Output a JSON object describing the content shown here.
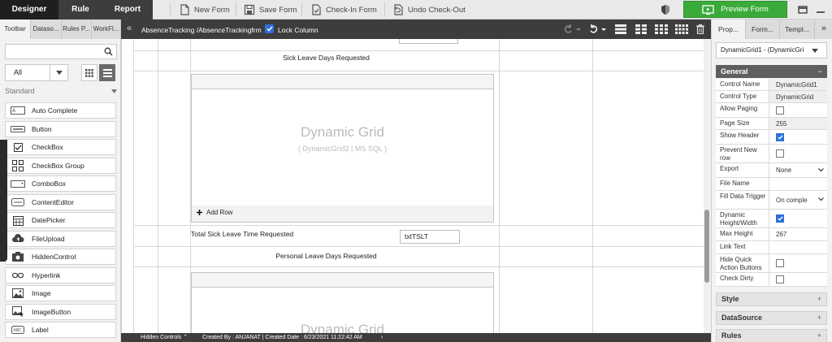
{
  "top_tabs": [
    "Designer",
    "Rule",
    "Report"
  ],
  "toolbar": {
    "new_form": "New Form",
    "save_form": "Save Form",
    "check_in_form": "Check-In Form",
    "undo_check_out": "Undo Check-Out",
    "preview_form": "Preview Form"
  },
  "left_tabs": [
    "Toolbar",
    "Dataso...",
    "Rules P...",
    "WorkFl..."
  ],
  "search": {
    "value": "",
    "placeholder": ""
  },
  "filter": {
    "selected": "All"
  },
  "section_title": "Standard",
  "tools": [
    "Auto Complete",
    "Button",
    "CheckBox",
    "CheckBox Group",
    "ComboBox",
    "ContentEditor",
    "DatePicker",
    "FileUpload",
    "HiddenControl",
    "Hyperlink",
    "Image",
    "ImageButton",
    "Label"
  ],
  "tool_icons": [
    "autocomplete-icon",
    "button-icon",
    "checkbox-icon",
    "checkbox-group-icon",
    "combobox-icon",
    "content-editor-icon",
    "datepicker-icon",
    "fileupload-icon",
    "hiddencontrol-icon",
    "hyperlink-icon",
    "image-icon",
    "imagebutton-icon",
    "label-icon"
  ],
  "breadcrumb": "AbsenceTracking /AbsenceTrackingfrm",
  "lock_column": {
    "label": "Lock Column",
    "checked": true
  },
  "canvas": {
    "sick_header": "Sick Leave Days Requested",
    "grid1_title": "Dynamic Grid",
    "grid1_sub": "( DynamicGrid2 | MS SQL )",
    "add_row": "Add Row",
    "total_label": "Total Sick Leave Time Requested",
    "total_field": "txtTSLT",
    "personal_header": "Personal Leave Days Requested",
    "grid2_title": "Dynamic Grid"
  },
  "status": {
    "hidden_controls": "Hidden Controls",
    "created": "Created By : ANJANAT | Created Date : 6/23/2021 11:22:42 AM"
  },
  "right_tabs": [
    "Prop...",
    "Form...",
    "Templ..."
  ],
  "control_select": "DynamicGrid1 - (DynamicGri",
  "general_title": "General",
  "properties": [
    {
      "name": "Control Name",
      "value": "DynamicGrid1",
      "kind": "plain"
    },
    {
      "name": "Control Type",
      "value": "DynamicGrid",
      "kind": "plain"
    },
    {
      "name": "Allow Paging",
      "value": "",
      "kind": "check",
      "checked": false
    },
    {
      "name": "Page Size",
      "value": "255",
      "kind": "plain"
    },
    {
      "name": "Show Header",
      "value": "",
      "kind": "check",
      "checked": true
    },
    {
      "name": "Prevent New row",
      "value": "",
      "kind": "check",
      "checked": false
    },
    {
      "name": "Export",
      "value": "None",
      "kind": "select"
    },
    {
      "name": "File Name",
      "value": "",
      "kind": "text"
    },
    {
      "name": "Fill Data Trigger",
      "value": "On comple",
      "kind": "select"
    },
    {
      "name": "Dynamic Height/Width",
      "value": "",
      "kind": "check",
      "checked": true
    },
    {
      "name": "Max Height",
      "value": "267",
      "kind": "text"
    },
    {
      "name": "Link Text",
      "value": "",
      "kind": "text"
    },
    {
      "name": "Hide Quick Action Buttons",
      "value": "",
      "kind": "check",
      "checked": false
    },
    {
      "name": "Check Dirty",
      "value": "",
      "kind": "check",
      "checked": false
    }
  ],
  "sections": [
    "Style",
    "DataSource",
    "Rules"
  ],
  "colors": {
    "accent": "#3aab3a",
    "dark": "#3d3d3d",
    "check": "#2f6fdb"
  }
}
